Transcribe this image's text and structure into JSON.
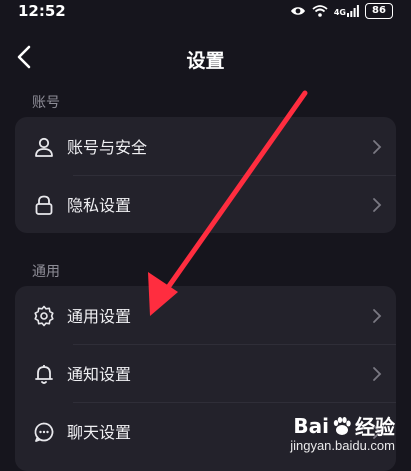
{
  "status_bar": {
    "time": "12:52",
    "network": "4G",
    "battery": "86",
    "icons": [
      "eye-icon",
      "wifi-icon",
      "signal-icon",
      "battery-icon"
    ]
  },
  "nav": {
    "title": "设置",
    "back_icon": "back-chevron-icon"
  },
  "sections": [
    {
      "label": "账号",
      "items": [
        {
          "label": "账号与安全",
          "icon": "person-icon"
        },
        {
          "label": "隐私设置",
          "icon": "lock-icon"
        }
      ]
    },
    {
      "label": "通用",
      "items": [
        {
          "label": "通用设置",
          "icon": "gear-icon"
        },
        {
          "label": "通知设置",
          "icon": "bell-icon"
        },
        {
          "label": "聊天设置",
          "icon": "chat-icon"
        }
      ]
    }
  ],
  "annotation": {
    "type": "arrow",
    "color": "#ff2d3f",
    "target": "通用设置"
  },
  "watermark": {
    "brand": "Bai",
    "brand_suffix": "经验",
    "url": "jingyan.baidu.com"
  },
  "colors": {
    "background": "#16151d",
    "card": "#23222b",
    "section_label": "#8e8d97"
  }
}
